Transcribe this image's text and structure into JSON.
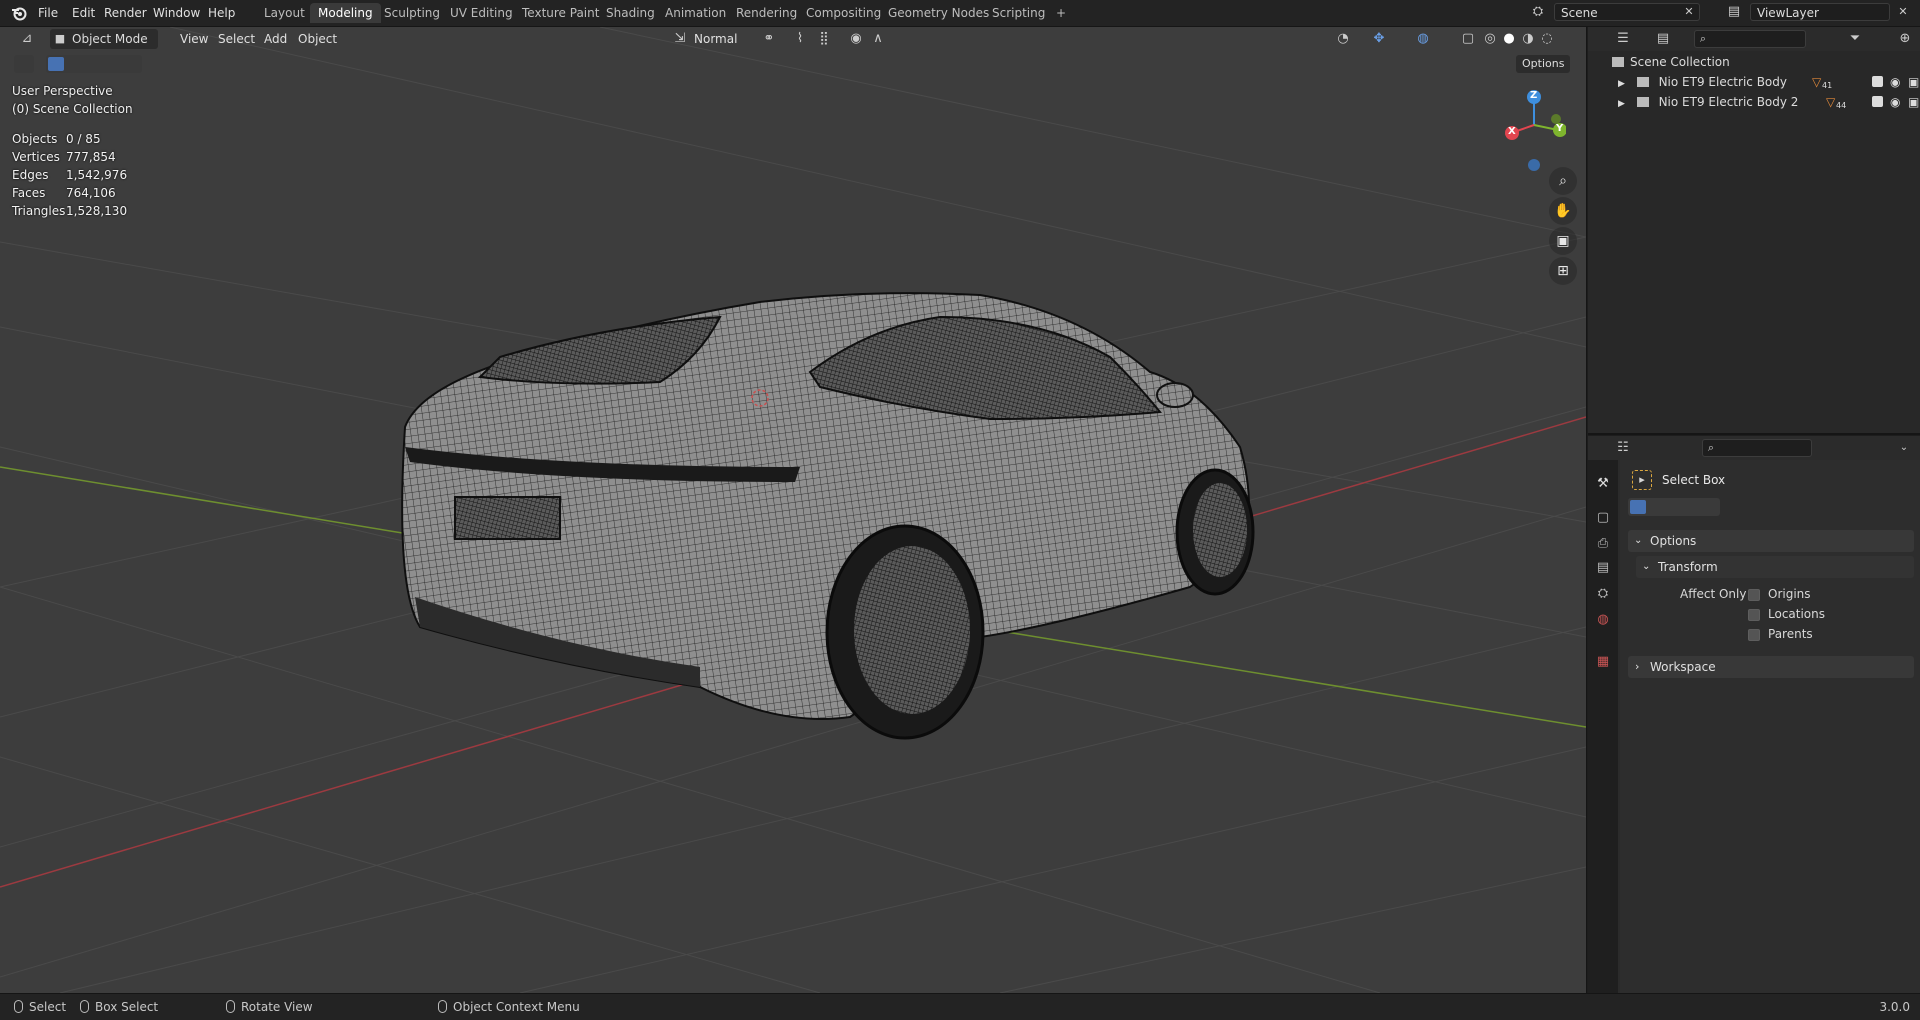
{
  "app": {
    "menus": [
      "File",
      "Edit",
      "Render",
      "Window",
      "Help"
    ],
    "workspaces": [
      "Layout",
      "Modeling",
      "Sculpting",
      "UV Editing",
      "Texture Paint",
      "Shading",
      "Animation",
      "Rendering",
      "Compositing",
      "Geometry Nodes",
      "Scripting"
    ],
    "active_workspace": "Modeling",
    "add_workspace": "+",
    "scene_name": "Scene",
    "view_layer": "ViewLayer"
  },
  "viewport": {
    "mode": "Object Mode",
    "menus": [
      "View",
      "Select",
      "Add",
      "Object"
    ],
    "transform_orientation": "Normal",
    "options_label": "Options",
    "perspective": "User Perspective",
    "collection_label": "(0) Scene Collection",
    "stats": [
      {
        "key": "Objects",
        "value": "0 / 85"
      },
      {
        "key": "Vertices",
        "value": "777,854"
      },
      {
        "key": "Edges",
        "value": "1,542,976"
      },
      {
        "key": "Faces",
        "value": "764,106"
      },
      {
        "key": "Triangles",
        "value": "1,528,130"
      }
    ],
    "gizmo": {
      "z": "Z",
      "y": "Y",
      "x": "X"
    },
    "nav_icons": [
      "zoom-icon",
      "hand-pan-icon",
      "camera-icon",
      "grid-ortho-icon"
    ]
  },
  "outliner": {
    "root": "Scene Collection",
    "items": [
      {
        "label": "Nio ET9 Electric Body",
        "badge": "41"
      },
      {
        "label": "Nio ET9 Electric Body 2",
        "badge": "44"
      }
    ]
  },
  "properties": {
    "tool_name": "Select Box",
    "sections": {
      "options": "Options",
      "transform": "Transform",
      "affect_only": "Affect Only",
      "workspace": "Workspace"
    },
    "checkboxes": [
      "Origins",
      "Locations",
      "Parents"
    ]
  },
  "statusbar": {
    "select": "Select",
    "box_select": "Box Select",
    "rotate_view": "Rotate View",
    "context_menu": "Object Context Menu",
    "version": "3.0.0"
  },
  "colors": {
    "accent": "#4772b3",
    "axis_x": "#e2454f",
    "axis_y": "#7fb52e",
    "axis_z": "#3e8fde",
    "viewport_bg": "#3d3d3d",
    "wire": "#111111"
  }
}
